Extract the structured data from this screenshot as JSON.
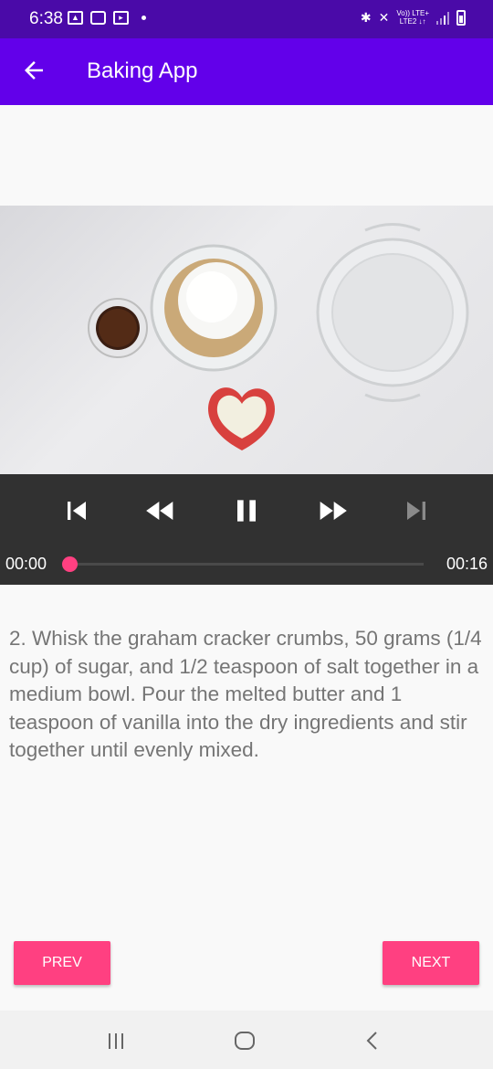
{
  "status_bar": {
    "time": "6:38",
    "left_icons": [
      "image-icon",
      "app-notification-icon",
      "tv-icon",
      "dot-icon"
    ],
    "right_icons": [
      "bluetooth-icon",
      "mute-icon",
      "signal-icon",
      "battery-icon"
    ],
    "network_label_top": "Vo)) LTE+",
    "network_label_bottom": "LTE2 ↓↑"
  },
  "app_bar": {
    "title": "Baking App",
    "nav_icon": "back-arrow-icon"
  },
  "player": {
    "current_time": "00:00",
    "duration": "00:16",
    "progress": 0.0,
    "controls": [
      "previous-icon",
      "rewind-icon",
      "pause-icon",
      "fast-forward-icon",
      "next-icon"
    ],
    "next_enabled": false
  },
  "step": {
    "description": "2. Whisk the graham cracker crumbs, 50 grams (1/4 cup) of sugar, and 1/2 teaspoon of salt together in a medium bowl. Pour the melted butter and 1 teaspoon of vanilla into the dry ingredients and stir together until evenly mixed."
  },
  "buttons": {
    "prev_label": "PREV",
    "next_label": "NEXT"
  },
  "nav_bar": {
    "icons": [
      "recents-icon",
      "home-icon",
      "back-icon"
    ]
  },
  "colors": {
    "status_bar": "#4a0aa8",
    "app_bar": "#6200ea",
    "accent": "#ff4081",
    "player_bg": "#313131",
    "text": "#757575"
  }
}
